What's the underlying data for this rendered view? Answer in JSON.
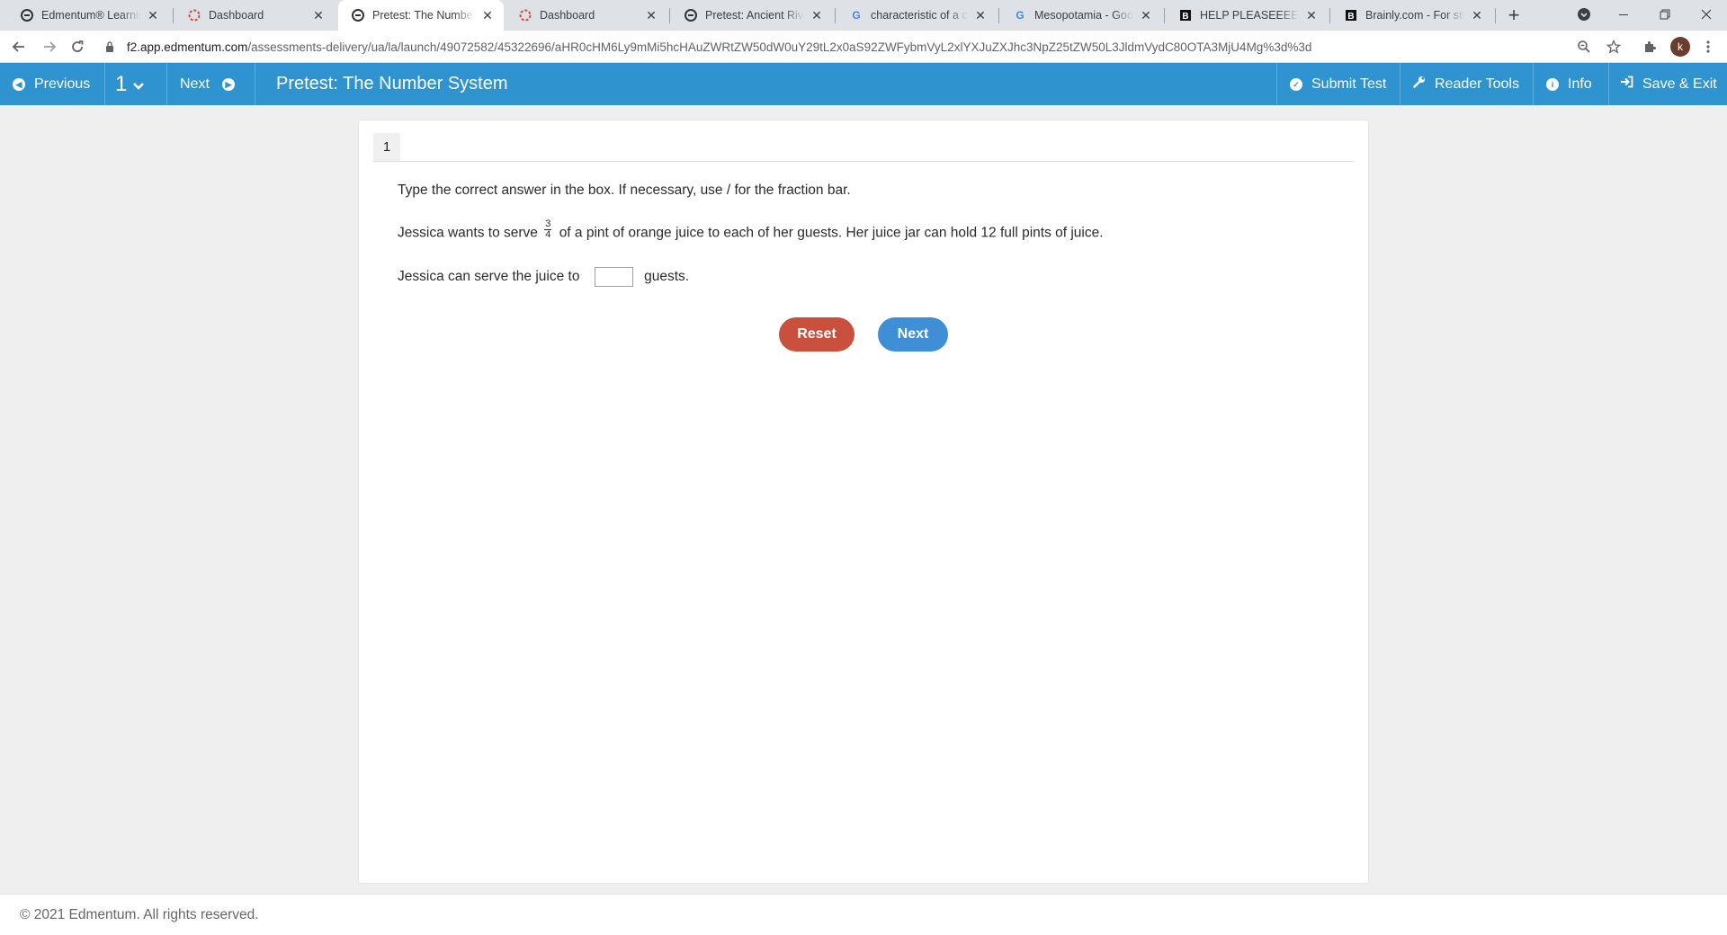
{
  "browser": {
    "tabs": [
      {
        "title": "Edmentum® Learning",
        "icon": "edmentum-icon"
      },
      {
        "title": "Dashboard",
        "icon": "dashboard-spinner-icon"
      },
      {
        "title": "Pretest: The Number S",
        "icon": "edmentum-icon",
        "active": true
      },
      {
        "title": "Dashboard",
        "icon": "dashboard-spinner-icon"
      },
      {
        "title": "Pretest: Ancient River C",
        "icon": "edmentum-icon"
      },
      {
        "title": "characteristic of a civili",
        "icon": "google-icon"
      },
      {
        "title": "Mesopotamia - Googl",
        "icon": "google-icon"
      },
      {
        "title": "HELP PLEASEEEEEE Dr",
        "icon": "brainly-icon"
      },
      {
        "title": "Brainly.com - For stude",
        "icon": "brainly-icon"
      }
    ],
    "new_tab": "+",
    "url_host": "f2.app.edmentum.com",
    "url_path": "/assessments-delivery/ua/la/launch/49072582/45322696/aHR0cHM6Ly9mMi5hcHAuZWRtZW50dW0uY29tL2x0aS92ZWFybmVyL2xlYXJuZXJhc3NpZ25tZW50L3JldmVydC80OTA3MjU4Mg%3d%3d",
    "profile_initial": "k"
  },
  "appbar": {
    "previous_label": "Previous",
    "question_selector": "1",
    "next_label": "Next",
    "title": "Pretest: The Number System",
    "submit_label": "Submit Test",
    "reader_tools_label": "Reader Tools",
    "info_label": "Info",
    "save_exit_label": "Save & Exit",
    "accent_color": "#2f93cf"
  },
  "question": {
    "number": "1",
    "instruction": "Type the correct answer in the box. If necessary, use / for the fraction bar.",
    "stem_before": "Jessica wants to serve",
    "fraction_numerator": "3",
    "fraction_denominator": "4",
    "stem_after": "of a pint of orange juice to each of her guests. Her juice jar can hold 12 full pints of juice.",
    "answer_prefix": "Jessica can serve the juice to",
    "answer_value": "",
    "answer_suffix": "guests.",
    "reset_label": "Reset",
    "next_label": "Next"
  },
  "footer": {
    "copyright": "© 2021 Edmentum. All rights reserved."
  }
}
